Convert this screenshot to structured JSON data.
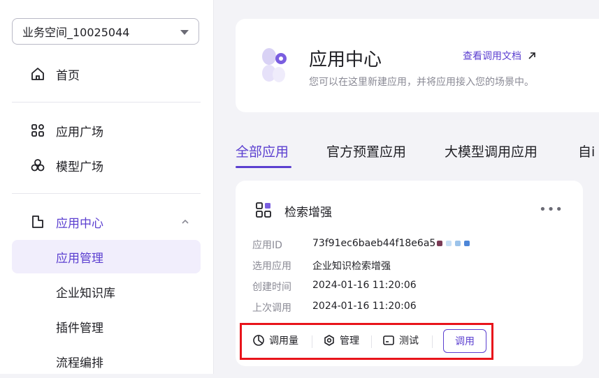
{
  "workspace": {
    "name": "业务空间_10025044"
  },
  "nav": {
    "home": "首页",
    "app_plaza": "应用广场",
    "model_plaza": "模型广场",
    "app_center": "应用中心",
    "sub_items": [
      "应用管理",
      "企业知识库",
      "插件管理",
      "流程编排"
    ]
  },
  "header": {
    "title": "应用中心",
    "description": "您可以在这里新建应用，并将应用接入您的场景中。",
    "doc_link": "查看调用文档"
  },
  "tabs": [
    "全部应用",
    "官方预置应用",
    "大模型调用应用",
    "自i"
  ],
  "app": {
    "name": "检索增强",
    "more": "•••",
    "fields": [
      {
        "label": "应用ID",
        "value": "73f91ec6baeb44f18e6a5"
      },
      {
        "label": "选用应用",
        "value": "企业知识检索增强"
      },
      {
        "label": "创建时间",
        "value": "2024-01-16 11:20:06"
      },
      {
        "label": "上次调用",
        "value": "2024-01-16 11:20:06"
      }
    ],
    "actions": {
      "usage": "调用量",
      "manage": "管理",
      "test": "测试",
      "call": "调用"
    }
  },
  "colors": {
    "accent": "#5b3fd0",
    "highlight": "#e8141b"
  }
}
